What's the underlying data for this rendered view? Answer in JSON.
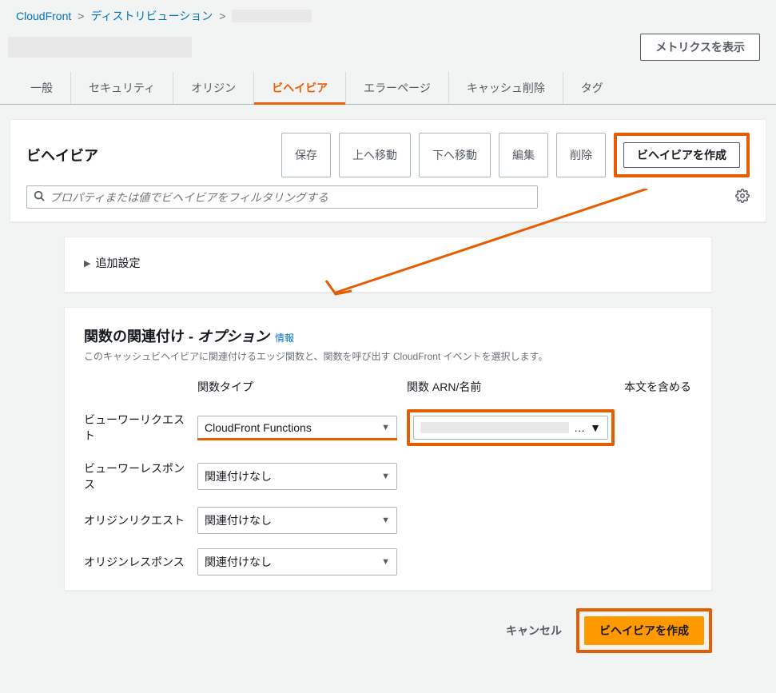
{
  "breadcrumb": {
    "root": "CloudFront",
    "dist": "ディストリビューション"
  },
  "header": {
    "metrics_btn": "メトリクスを表示"
  },
  "tabs": {
    "general": "一般",
    "security": "セキュリティ",
    "origin": "オリジン",
    "behavior": "ビヘイビア",
    "error": "エラーページ",
    "invalidation": "キャッシュ削除",
    "tags": "タグ"
  },
  "behavior_panel": {
    "title": "ビヘイビア",
    "save": "保存",
    "move_up": "上へ移動",
    "move_down": "下へ移動",
    "edit": "編集",
    "delete": "削除",
    "create": "ビヘイビアを作成",
    "search_placeholder": "プロパティまたは値でビヘイビアをフィルタリングする"
  },
  "additional": {
    "label": "追加設定"
  },
  "func_assoc": {
    "title": "関数の関連付け - ",
    "optional": "オプション",
    "info": "情報",
    "desc": "このキャッシュビヘイビアに関連付けるエッジ関数と、関数を呼び出す CloudFront イベントを選択します。",
    "col_type": "関数タイプ",
    "col_arn": "関数 ARN/名前",
    "col_body": "本文を含める",
    "rows": {
      "viewer_req": {
        "label": "ビューワーリクエスト",
        "type": "CloudFront Functions"
      },
      "viewer_res": {
        "label": "ビューワーレスポンス",
        "type": "関連付けなし"
      },
      "origin_req": {
        "label": "オリジンリクエスト",
        "type": "関連付けなし"
      },
      "origin_res": {
        "label": "オリジンレスポンス",
        "type": "関連付けなし"
      }
    },
    "arn_suffix": "…"
  },
  "footer": {
    "cancel": "キャンセル",
    "create": "ビヘイビアを作成"
  }
}
